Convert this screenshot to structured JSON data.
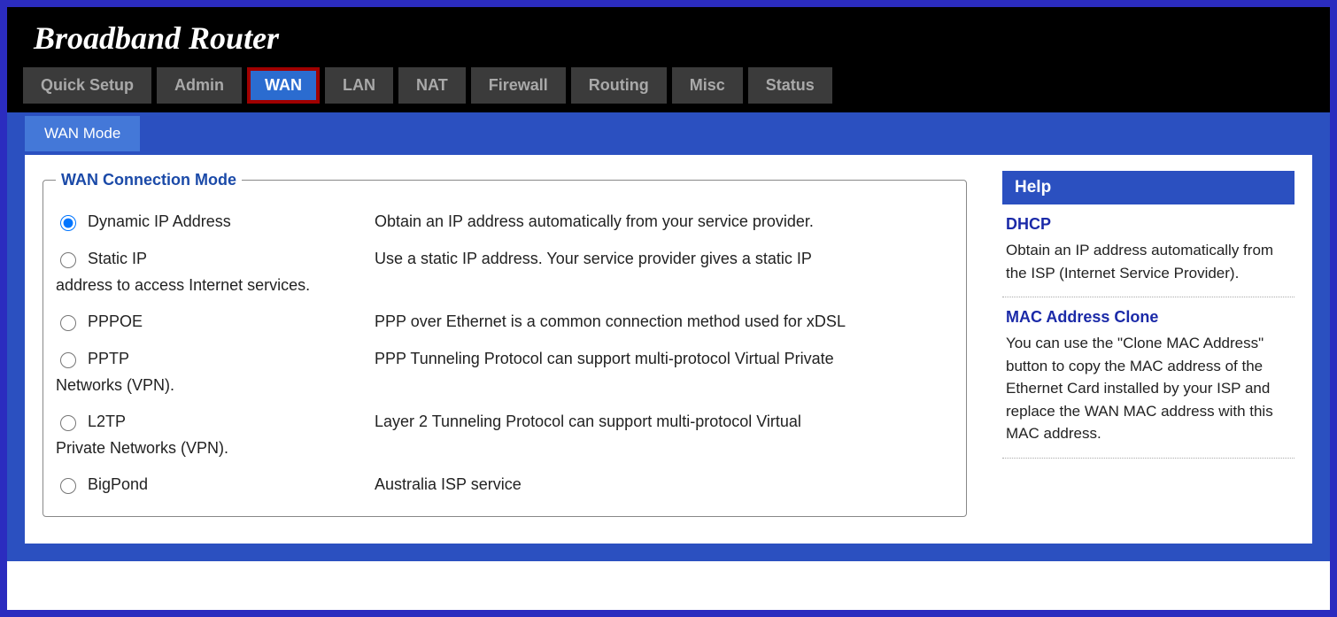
{
  "header": {
    "title": "Broadband Router"
  },
  "nav": {
    "items": [
      {
        "label": "Quick Setup",
        "active": false
      },
      {
        "label": "Admin",
        "active": false
      },
      {
        "label": "WAN",
        "active": true
      },
      {
        "label": "LAN",
        "active": false
      },
      {
        "label": "NAT",
        "active": false
      },
      {
        "label": "Firewall",
        "active": false
      },
      {
        "label": "Routing",
        "active": false
      },
      {
        "label": "Misc",
        "active": false
      },
      {
        "label": "Status",
        "active": false
      }
    ]
  },
  "subnav": {
    "label": "WAN Mode"
  },
  "fieldset": {
    "legend": "WAN Connection Mode",
    "options": [
      {
        "label": "Dynamic IP Address",
        "checked": true,
        "desc": "Obtain an IP address automatically from your service provider.",
        "cont": ""
      },
      {
        "label": "Static IP",
        "checked": false,
        "desc": "Use a static IP address. Your service provider gives a static IP",
        "cont": "address to access Internet services."
      },
      {
        "label": "PPPOE",
        "checked": false,
        "desc": "PPP over Ethernet is a common connection method used for xDSL",
        "cont": ""
      },
      {
        "label": "PPTP",
        "checked": false,
        "desc": "PPP Tunneling Protocol can support multi-protocol Virtual Private",
        "cont": "Networks (VPN)."
      },
      {
        "label": "L2TP",
        "checked": false,
        "desc": "Layer 2 Tunneling Protocol can support multi-protocol Virtual",
        "cont": "Private Networks (VPN)."
      },
      {
        "label": "BigPond",
        "checked": false,
        "desc": "Australia ISP service",
        "cont": ""
      }
    ]
  },
  "help": {
    "header": "Help",
    "items": [
      {
        "title": "DHCP",
        "text": "Obtain an IP address automatically from the ISP (Internet Service Provider)."
      },
      {
        "title": "MAC Address Clone",
        "text": "You can use the \"Clone MAC Address\" button to copy the MAC address of the Ethernet Card installed by your ISP and replace the WAN MAC address with this MAC address."
      }
    ]
  }
}
